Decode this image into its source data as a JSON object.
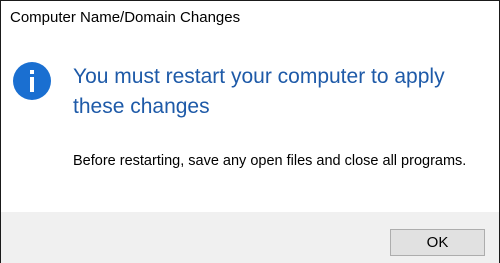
{
  "window": {
    "title": "Computer Name/Domain Changes"
  },
  "dialog": {
    "icon": "info-icon",
    "heading": "You must restart your computer to apply these changes",
    "message": "Before restarting, save any open files and close all programs.",
    "accent_color": "#1e5aa8",
    "icon_color": "#1a6fd1"
  },
  "buttons": {
    "ok_label": "OK"
  }
}
